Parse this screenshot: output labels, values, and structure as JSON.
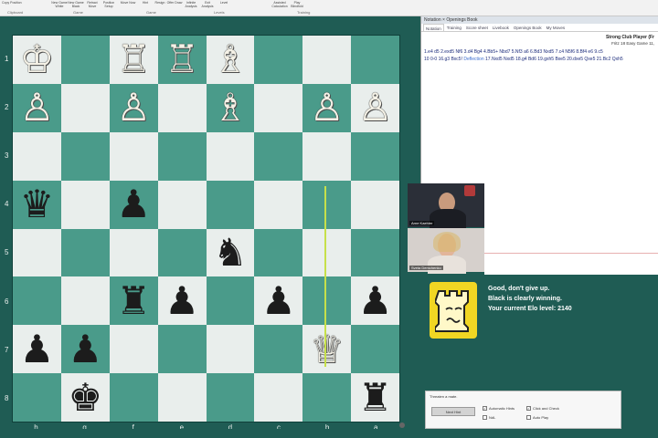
{
  "ribbon": {
    "items": [
      "Copy Position",
      "New Game White",
      "New Game Black",
      "Retract Move",
      "Position Setup",
      "Move Now",
      "Hint",
      "Resign",
      "Offer Draw",
      "Infinite Analysis",
      "Exit Analysis",
      "Level",
      "Assisted Calculation",
      "Play Blindfold"
    ],
    "groups": [
      "Clipboard",
      "Game",
      "Game",
      "Levels",
      "Training"
    ]
  },
  "board": {
    "ranks": [
      "1",
      "2",
      "3",
      "4",
      "5",
      "6",
      "7",
      "8"
    ],
    "files": [
      "h",
      "g",
      "f",
      "e",
      "d",
      "c",
      "b",
      "a"
    ],
    "rows": [
      [
        {
          "p": "♔",
          "c": "w",
          "n": "white-king"
        },
        null,
        {
          "p": "♖",
          "c": "w",
          "n": "white-rook"
        },
        {
          "p": "♖",
          "c": "w",
          "n": "white-rook"
        },
        {
          "p": "♗",
          "c": "w",
          "n": "white-bishop"
        },
        null,
        null,
        null
      ],
      [
        {
          "p": "♙",
          "c": "w",
          "n": "white-pawn"
        },
        null,
        {
          "p": "♙",
          "c": "w",
          "n": "white-pawn"
        },
        null,
        {
          "p": "♗",
          "c": "w",
          "n": "white-bishop"
        },
        null,
        {
          "p": "♙",
          "c": "w",
          "n": "white-pawn"
        },
        {
          "p": "♙",
          "c": "w",
          "n": "white-pawn"
        }
      ],
      [
        null,
        null,
        null,
        null,
        null,
        null,
        null,
        null
      ],
      [
        {
          "p": "♛",
          "c": "b",
          "n": "black-queen"
        },
        null,
        {
          "p": "♟",
          "c": "b",
          "n": "black-pawn"
        },
        null,
        null,
        null,
        null,
        null
      ],
      [
        null,
        null,
        null,
        null,
        {
          "p": "♞",
          "c": "b",
          "n": "black-knight"
        },
        null,
        null,
        null
      ],
      [
        null,
        null,
        {
          "p": "♜",
          "c": "b",
          "n": "black-rook"
        },
        {
          "p": "♟",
          "c": "b",
          "n": "black-pawn"
        },
        null,
        {
          "p": "♟",
          "c": "b",
          "n": "black-pawn"
        },
        null,
        {
          "p": "♟",
          "c": "b",
          "n": "black-pawn"
        }
      ],
      [
        {
          "p": "♟",
          "c": "b",
          "n": "black-pawn"
        },
        {
          "p": "♟",
          "c": "b",
          "n": "black-pawn"
        },
        null,
        null,
        null,
        null,
        {
          "p": "♕",
          "c": "w",
          "n": "white-queen"
        },
        null
      ],
      [
        null,
        {
          "p": "♚",
          "c": "b",
          "n": "black-king"
        },
        null,
        null,
        null,
        null,
        null,
        {
          "p": "♜",
          "c": "b",
          "n": "black-rook"
        }
      ]
    ]
  },
  "notation": {
    "title": "Notation × Openings Book",
    "tabs": [
      "Notation",
      "Training",
      "Score sheet",
      "Livebook",
      "Openings Book",
      "My Moves"
    ],
    "player": "Strong Club Player (Fr",
    "event": "Fritz 18 Easy Game 11,",
    "moves_line1": "1.e4 d5 2.exd5 Nf6 3.d4 Bg4 4.Bb5+ Nbd7 5.Nf3 a6 6.Bd3 Nxd5 7.c4 N5f6 8.Bf4 e6 9.c5",
    "moves_line2_a": "10 0-0 16.g3 Bxc5!",
    "moves_line2_hl": "Deflection",
    "moves_line2_b": "17.Nxd5 Nxd5 18.g4 Bd6 19.gxh5 Bxe5 20.dxe5 Qxe5 21.Bc2 Qxh5"
  },
  "webcams": {
    "cam1_label": "Arne Kaehler",
    "cam2_label": "Sveta Demchenko"
  },
  "coach": {
    "line1": "Good, don't give up.",
    "line2": "Black is clearly winning.",
    "line3": "Your current Elo level: 2140"
  },
  "mini_panel": {
    "title": "Threaten a mate.",
    "button": "Next Hint",
    "check_auto_hints": "Automatic Hints",
    "check_click_check": "Click and Check",
    "check_ndl": "NdL",
    "check_auto_play": "Auto Play"
  },
  "colors": {
    "light_square": "#e9eeec",
    "dark_square": "#4a9b8a",
    "frame": "#1f5c54",
    "arrow": "#c6e04a",
    "coach_icon": "#f1d623"
  }
}
